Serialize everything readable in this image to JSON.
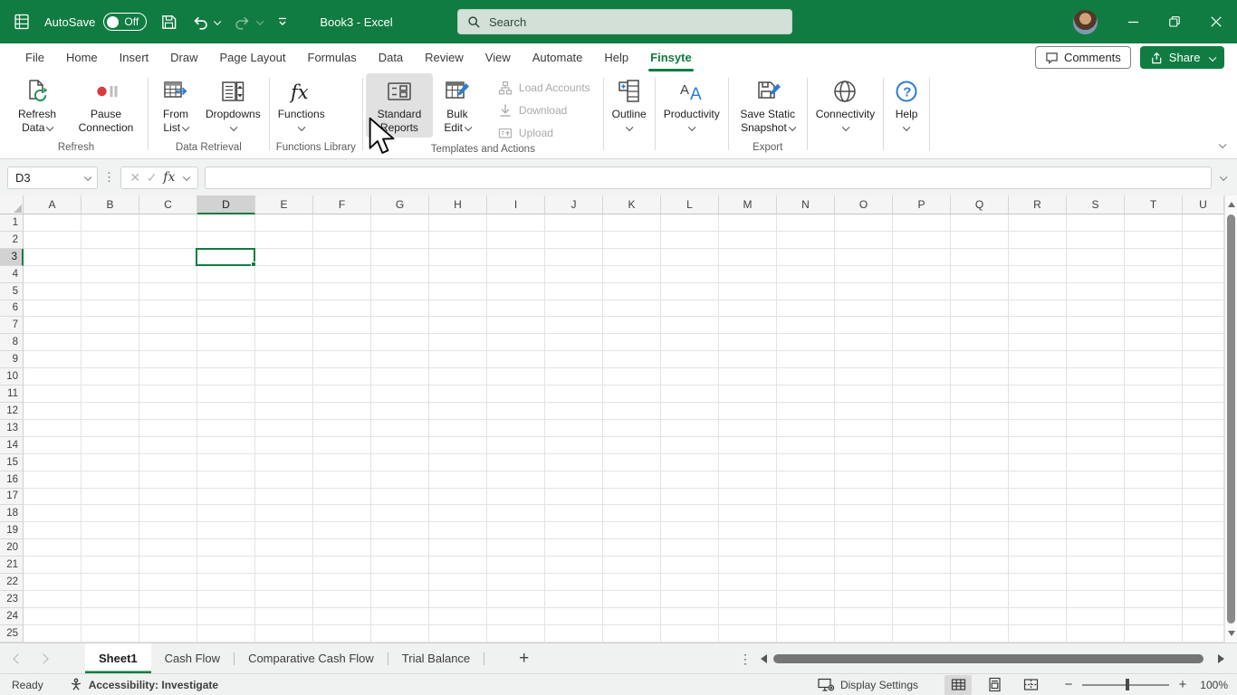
{
  "colors": {
    "accent_green": "#107C41",
    "titlebar_green": "#107C41",
    "hover_grey": "#e1e1e1",
    "disabled_text": "#a9a9a9",
    "selected_header_bg": "#d2d2d2",
    "icon_blue": "#2b7cd3",
    "pause_red": "#d83b3b"
  },
  "titlebar": {
    "autosave_label": "AutoSave",
    "autosave_state": "Off",
    "doc_title": "Book3  -  Excel",
    "search_placeholder": "Search"
  },
  "menu_tabs": {
    "items": [
      {
        "label": "File"
      },
      {
        "label": "Home"
      },
      {
        "label": "Insert"
      },
      {
        "label": "Draw"
      },
      {
        "label": "Page Layout"
      },
      {
        "label": "Formulas"
      },
      {
        "label": "Data"
      },
      {
        "label": "Review"
      },
      {
        "label": "View"
      },
      {
        "label": "Automate"
      },
      {
        "label": "Help"
      },
      {
        "label": "Finsyte",
        "active": true
      }
    ]
  },
  "actions": {
    "comments_label": "Comments",
    "share_label": "Share"
  },
  "ribbon": {
    "group_labels": {
      "refresh": "Refresh",
      "data_retrieval": "Data Retrieval",
      "functions_library": "Functions Library",
      "templates_and_actions": "Templates and Actions",
      "export": "Export"
    },
    "buttons": {
      "refresh_data": "Refresh Data",
      "pause_connection": "Pause Connection",
      "from_list": "From List",
      "dropdowns": "Dropdowns",
      "functions": "Functions",
      "standard_reports": "Standard Reports",
      "bulk_edit": "Bulk Edit",
      "load_accounts": "Load Accounts",
      "download": "Download",
      "upload": "Upload",
      "outline": "Outline",
      "productivity": "Productivity",
      "save_static_snapshot": "Save Static Snapshot",
      "connectivity": "Connectivity",
      "help": "Help"
    },
    "disabled_buttons": [
      "Load Accounts",
      "Download",
      "Upload"
    ],
    "hovered_button": "Standard Reports"
  },
  "formula_bar": {
    "name_box_value": "D3",
    "formula_value": ""
  },
  "grid": {
    "columns": [
      "A",
      "B",
      "C",
      "D",
      "E",
      "F",
      "G",
      "H",
      "I",
      "J",
      "K",
      "L",
      "M",
      "N",
      "O",
      "P",
      "Q",
      "R",
      "S",
      "T",
      "U"
    ],
    "row_count": 25,
    "selected": {
      "cell_ref": "D3",
      "column": "D",
      "row": 3
    }
  },
  "sheet_bar": {
    "tabs": [
      {
        "label": "Sheet1",
        "active": true
      },
      {
        "label": "Cash Flow"
      },
      {
        "label": "Comparative Cash Flow"
      },
      {
        "label": "Trial Balance"
      }
    ]
  },
  "status_bar": {
    "mode": "Ready",
    "accessibility": "Accessibility: Investigate",
    "display_settings": "Display Settings",
    "zoom_level": "100%"
  },
  "icons": [
    "excel-logo-icon",
    "save-icon",
    "undo-icon",
    "redo-icon",
    "quick-access-icon",
    "search-icon",
    "avatar",
    "minimize-icon",
    "restore-icon",
    "close-icon",
    "comment-icon",
    "share-icon",
    "refresh-data-icon",
    "pause-connection-icon",
    "from-list-icon",
    "dropdowns-icon",
    "functions-fx-icon",
    "standard-reports-icon",
    "bulk-edit-icon",
    "load-accounts-icon",
    "download-icon",
    "upload-icon",
    "outline-icon",
    "productivity-icon",
    "save-snapshot-icon",
    "connectivity-globe-icon",
    "help-icon",
    "accessibility-icon",
    "display-settings-icon",
    "normal-view-icon",
    "page-layout-view-icon",
    "page-break-view-icon"
  ]
}
